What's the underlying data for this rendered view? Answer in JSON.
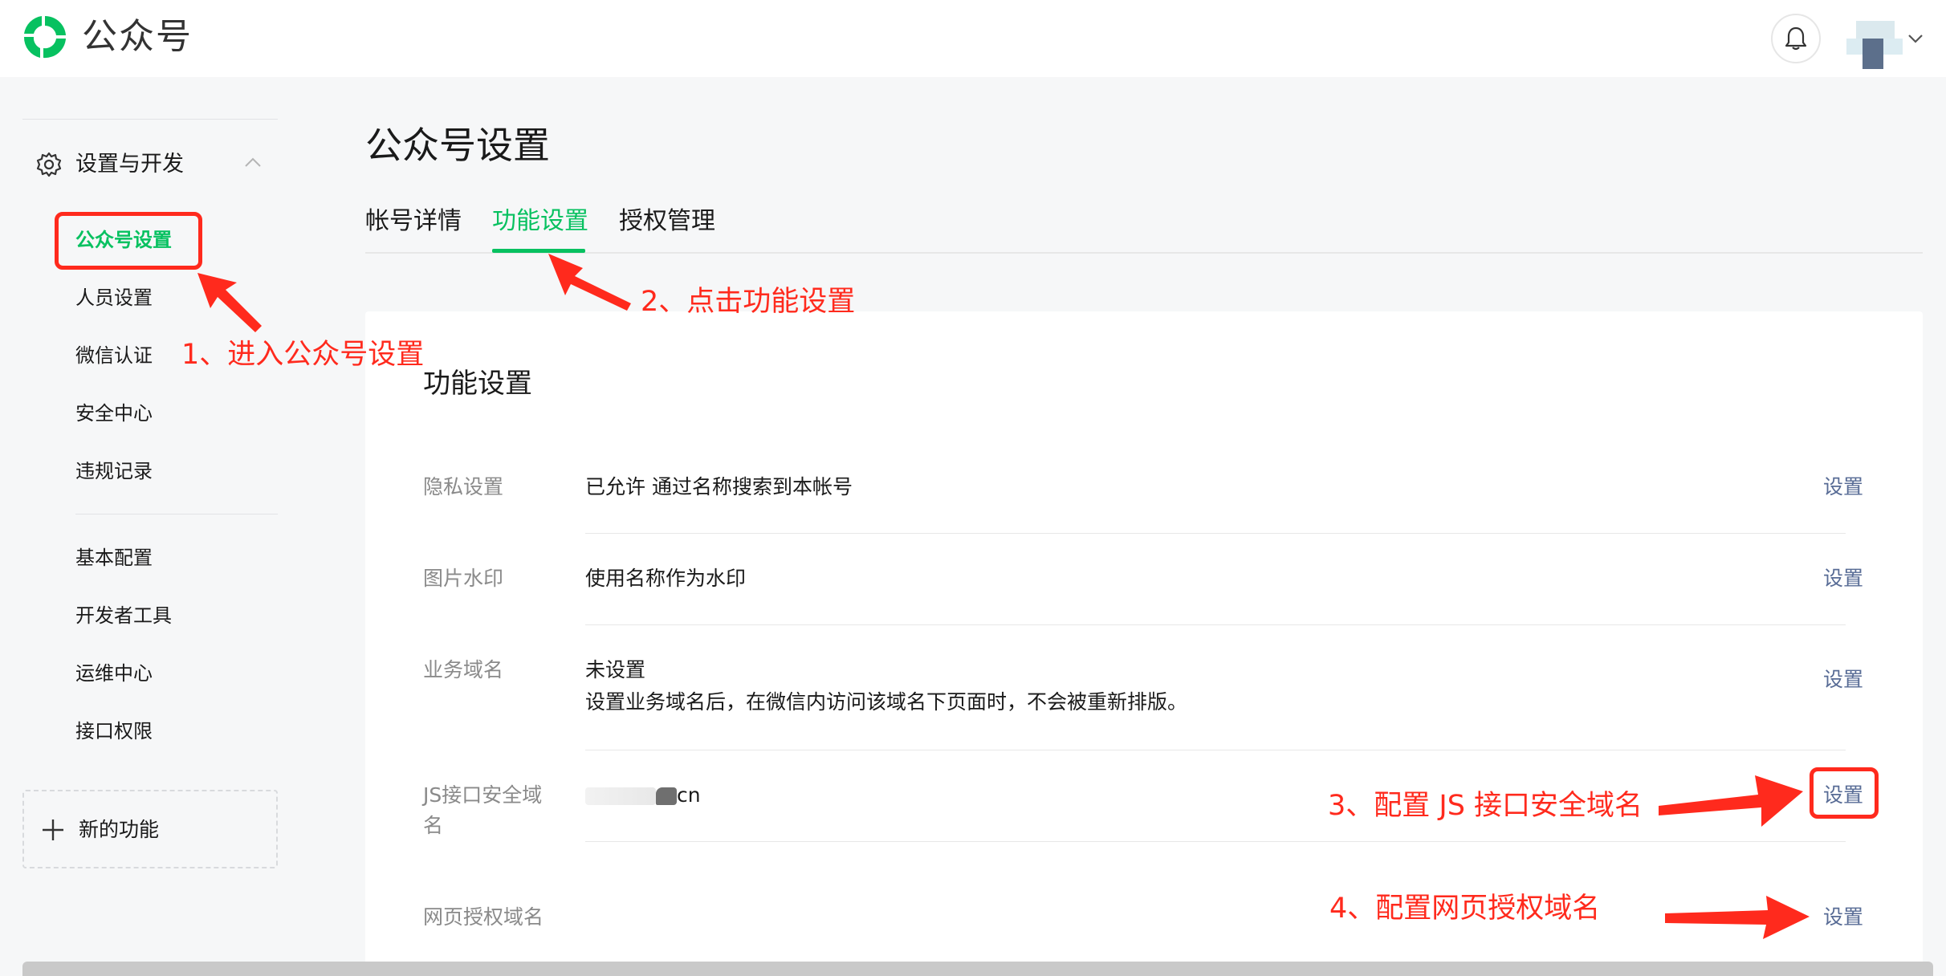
{
  "header": {
    "brand": "公众号"
  },
  "sidebar": {
    "group_label": "设置与开发",
    "items": [
      "公众号设置",
      "人员设置",
      "微信认证",
      "安全中心",
      "违规记录"
    ],
    "items2": [
      "基本配置",
      "开发者工具",
      "运维中心",
      "接口权限"
    ],
    "new_func": "新的功能"
  },
  "main": {
    "title": "公众号设置",
    "tabs": [
      "帐号详情",
      "功能设置",
      "授权管理"
    ],
    "card_title": "功能设置",
    "rows": [
      {
        "label": "隐私设置",
        "value": "已允许 通过名称搜索到本帐号",
        "action": "设置"
      },
      {
        "label": "图片水印",
        "value": "使用名称作为水印",
        "action": "设置"
      },
      {
        "label": "业务域名",
        "value": "未设置",
        "desc": "设置业务域名后，在微信内访问该域名下页面时，不会被重新排版。",
        "action": "设置"
      },
      {
        "label": "JS接口安全域名",
        "value_suffix": "cn",
        "action": "设置"
      },
      {
        "label": "网页授权域名",
        "action": "设置"
      }
    ]
  },
  "annotations": {
    "a1": "1、进入公众号设置",
    "a2": "2、点击功能设置",
    "a3": "3、配置 JS 接口安全域名",
    "a4": "4、配置网页授权域名"
  },
  "colors": {
    "accent": "#07c160",
    "link": "#576b95",
    "annotation": "#ff2a1d"
  }
}
